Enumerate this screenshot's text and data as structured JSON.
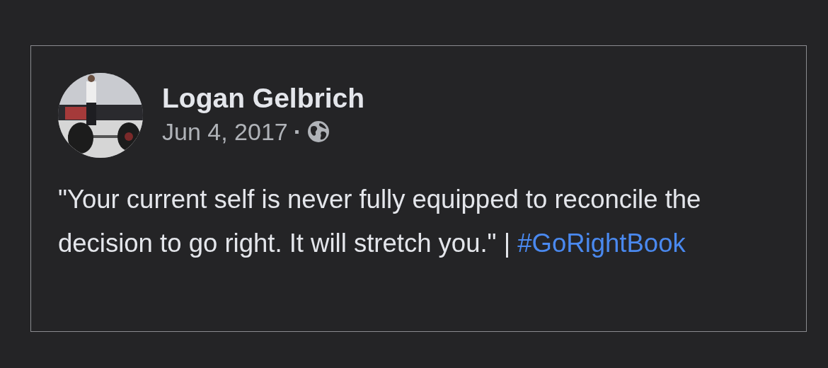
{
  "post": {
    "author": "Logan Gelbrich",
    "date": "Jun 4, 2017",
    "separator": "·",
    "text": "\"Your current self is never fully equipped to reconcile the decision to go right. It will stretch you.\" | ",
    "hashtag": "#GoRightBook"
  }
}
